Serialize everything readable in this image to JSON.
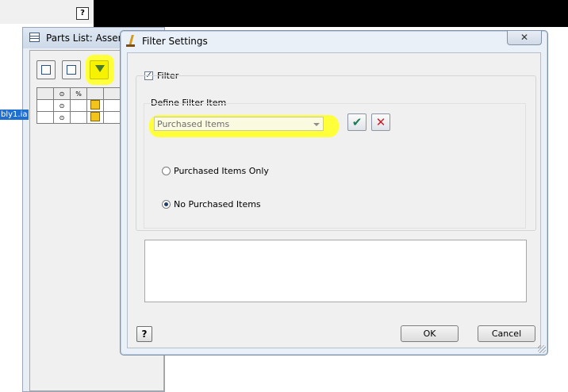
{
  "background": {
    "help_glyph": "?"
  },
  "parts_list": {
    "title": "Parts List: Assem",
    "selected_item": "bly1.ia"
  },
  "dialog": {
    "title": "Filter Settings",
    "close_glyph": "✕",
    "filter_checkbox_label": "Filter",
    "filter_checked": true,
    "group_label": "Define Filter Item",
    "filter_item_value": "Purchased Items",
    "radio_options": [
      {
        "label": "Purchased Items Only",
        "selected": false
      },
      {
        "label": "No Purchased Items",
        "selected": true
      }
    ],
    "help_glyph": "?",
    "ok_label": "OK",
    "cancel_label": "Cancel"
  },
  "colors": {
    "highlight": "#ffff3a",
    "apply_check": "#1f7a55",
    "remove_x": "#c8202a",
    "selection": "#1e6fd0"
  },
  "icons": {
    "apply": "check-icon",
    "remove": "x-icon",
    "filter_tool": "funnel-icon"
  }
}
